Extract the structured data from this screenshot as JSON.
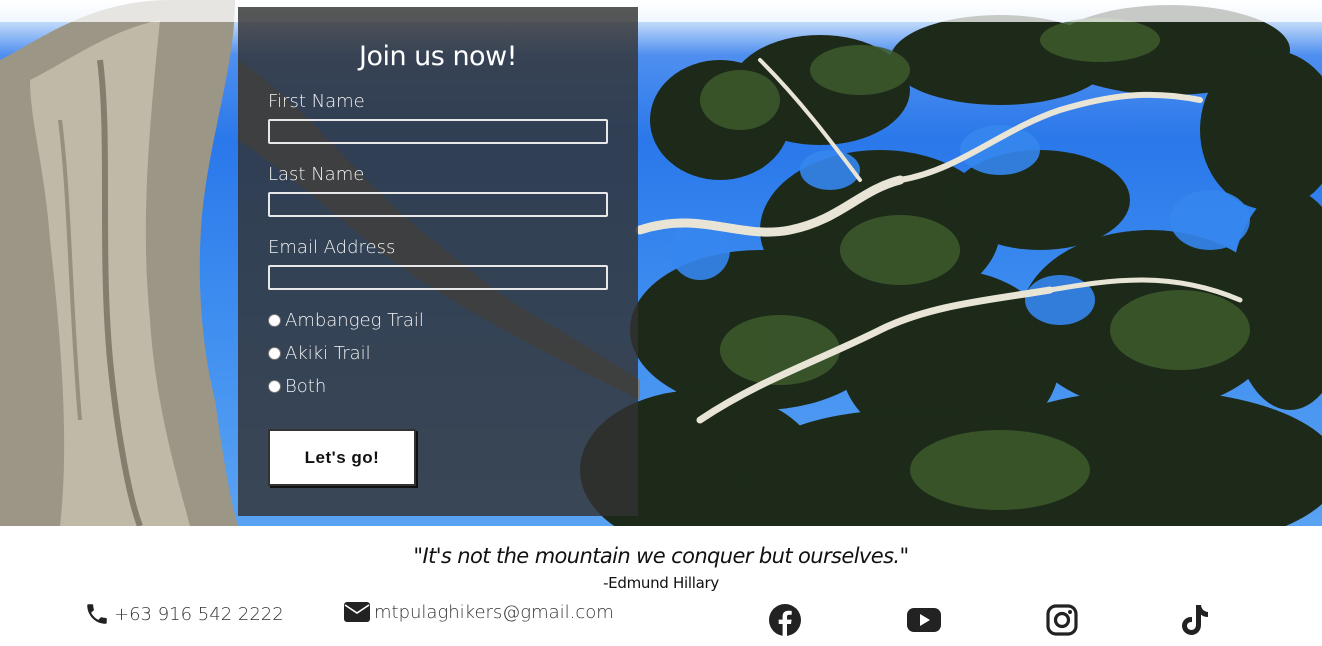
{
  "form": {
    "title": "Join us now!",
    "first_name_label": "First Name",
    "first_name_value": "",
    "last_name_label": "Last Name",
    "last_name_value": "",
    "email_label": "Email Address",
    "email_value": "",
    "trail_options": [
      "Ambangeg Trail",
      "Akiki Trail",
      "Both"
    ],
    "submit_label": "Let's go!"
  },
  "footer": {
    "quote": "\"It's not the mountain we conquer but ourselves.\"",
    "author": "-Edmund Hillary",
    "phone": "+63 916 542 2222",
    "email": "mtpulaghikers@gmail.com",
    "social_icons": [
      "facebook-icon",
      "youtube-icon",
      "instagram-icon",
      "tiktok-icon"
    ]
  },
  "colors": {
    "sky": "#2a78ea",
    "card_background": "#323232",
    "text_on_card": "#ffffff",
    "footer_text": "#111111"
  }
}
